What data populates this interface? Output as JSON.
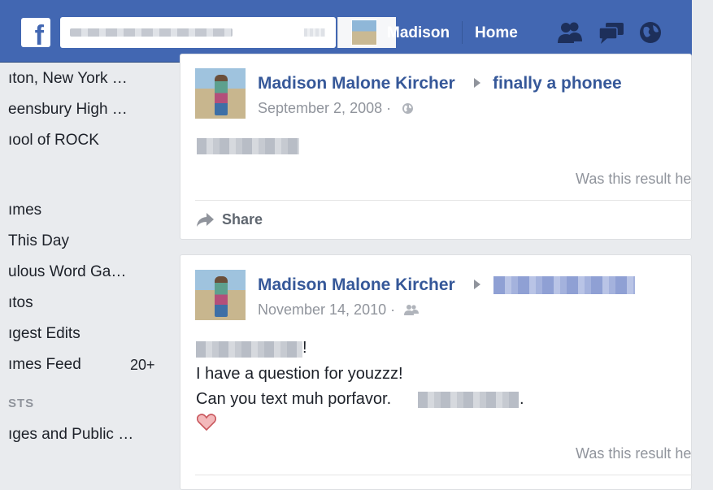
{
  "header": {
    "logo": "f",
    "search_placeholder": "",
    "user_name": "Madison",
    "home_label": "Home",
    "icons": [
      "friend-requests-icon",
      "messages-icon",
      "notifications-icon"
    ]
  },
  "sidebar": {
    "items": [
      {
        "label": "ıton, New York …"
      },
      {
        "label": "eensbury High …"
      },
      {
        "label": "ıool of ROCK"
      },
      {
        "label": "ımes"
      },
      {
        "label": "This Day"
      },
      {
        "label": "ulous Word Ga…"
      },
      {
        "label": "ıtos"
      },
      {
        "label": "ıgest Edits"
      },
      {
        "label": "ımes Feed",
        "count": "20+"
      },
      {
        "label": "ıges and Public …"
      }
    ],
    "section_label": "STS"
  },
  "posts": [
    {
      "author": "Madison Malone Kircher",
      "target": "finally a phonee",
      "date": "September 2, 2008 ·",
      "privacy_icon": "globe-icon",
      "was_result": "Was this result he",
      "share_label": "Share"
    },
    {
      "author": "Madison Malone Kircher",
      "date": "November 14, 2010 ·",
      "privacy_icon": "friends-icon",
      "line1_suffix": "!",
      "line2": "I have a question for youzzz!",
      "line3": "Can you text muh porfavor.",
      "line3_suffix": ".",
      "was_result": "Was this result he"
    }
  ],
  "colors": {
    "brand": "#4267b2",
    "link": "#365899",
    "muted": "#90949c",
    "heart": "#e0787d"
  }
}
